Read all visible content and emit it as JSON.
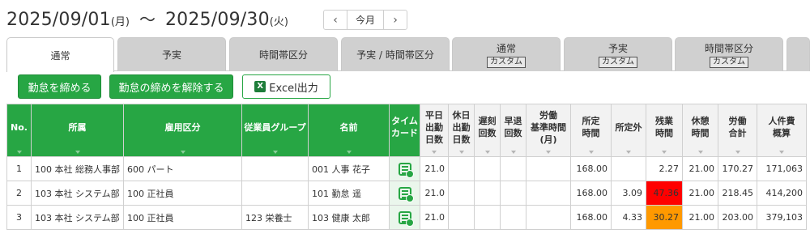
{
  "period": {
    "start_date": "2025/09/01",
    "start_dow": "(月)",
    "tilde": "～",
    "end_date": "2025/09/30",
    "end_dow": "(火)"
  },
  "nav": {
    "prev": "‹",
    "today": "今月",
    "next": "›"
  },
  "tabs": [
    {
      "label": "通常",
      "sub": "",
      "active": true
    },
    {
      "label": "予実",
      "sub": ""
    },
    {
      "label": "時間帯区分",
      "sub": ""
    },
    {
      "label": "予実 / 時間帯区分",
      "sub": ""
    },
    {
      "label": "通常",
      "sub": "カスタム"
    },
    {
      "label": "予実",
      "sub": "カスタム"
    },
    {
      "label": "時間帯区分",
      "sub": "カスタム"
    },
    {
      "label": "",
      "sub": ""
    }
  ],
  "actions": {
    "close_label": "勤怠を締める",
    "unclose_label": "勤怠の締めを解除する",
    "excel_label": "Excel出力",
    "excel_icon": "X"
  },
  "columns": {
    "no": "No.",
    "dept": "所属",
    "emp_type": "雇用区分",
    "group": "従業員グループ",
    "name": "名前",
    "timecard": [
      "タイム",
      "カード"
    ],
    "weekday_days": [
      "平日",
      "出勤",
      "日数"
    ],
    "holiday_days": [
      "休日",
      "出勤",
      "日数"
    ],
    "late": [
      "遅刻",
      "回数"
    ],
    "early": [
      "早退",
      "回数"
    ],
    "labor_base": [
      "労働",
      "基準時間",
      "(月)"
    ],
    "scheduled": [
      "所定",
      "時間"
    ],
    "non_scheduled": "所定外",
    "overtime": [
      "残業",
      "時間"
    ],
    "break": [
      "休憩",
      "時間"
    ],
    "labor_total": [
      "労働",
      "合計"
    ],
    "cost": [
      "人件費",
      "概算"
    ]
  },
  "rows": [
    {
      "no": "1",
      "dept": "100 本社 総務人事部",
      "emp_type": "600 パート",
      "group": "",
      "name": "001 人事 花子",
      "weekday_days": "21.0",
      "holiday_days": "",
      "late": "",
      "early": "",
      "labor_base": "",
      "scheduled": "168.00",
      "non_scheduled": "",
      "overtime": "2.27",
      "break": "21.00",
      "labor_total": "170.27",
      "cost": "171,063",
      "overtime_color": ""
    },
    {
      "no": "2",
      "dept": "103 本社 システム部",
      "emp_type": "100 正社員",
      "group": "",
      "name": "101 勤怠 遥",
      "weekday_days": "21.0",
      "holiday_days": "",
      "late": "",
      "early": "",
      "labor_base": "",
      "scheduled": "168.00",
      "non_scheduled": "3.09",
      "overtime": "47.36",
      "break": "21.00",
      "labor_total": "218.45",
      "cost": "414,200",
      "overtime_color": "#ff0000"
    },
    {
      "no": "3",
      "dept": "103 本社 システム部",
      "emp_type": "100 正社員",
      "group": "123 栄養士",
      "name": "103 健康 太郎",
      "weekday_days": "21.0",
      "holiday_days": "",
      "late": "",
      "early": "",
      "labor_base": "",
      "scheduled": "168.00",
      "non_scheduled": "4.33",
      "overtime": "30.27",
      "break": "21.00",
      "labor_total": "203.00",
      "cost": "379,103",
      "overtime_color": "#ff9900"
    }
  ],
  "icons": {
    "timecard": "timecard-icon",
    "excel": "excel-icon",
    "prev": "chevron-left-icon",
    "next": "chevron-right-icon"
  },
  "colors": {
    "accent": "#27a644",
    "overtime_high": "#ff0000",
    "overtime_warn": "#ff9900"
  }
}
